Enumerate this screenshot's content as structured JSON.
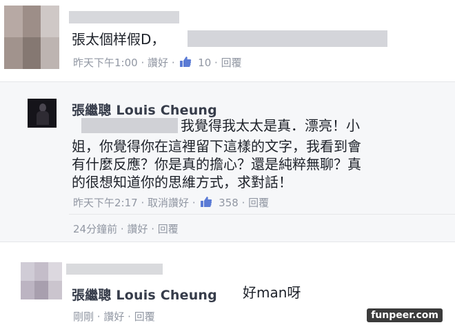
{
  "comments": [
    {
      "text": "張太個样假D，",
      "meta": {
        "time": "昨天下午1:00",
        "action": "讚好",
        "likes": "10",
        "reply": "回覆"
      }
    }
  ],
  "reply": {
    "author": "張繼聰 Louis Cheung",
    "lines": [
      "我覺得我太太是真．漂亮！小",
      "姐，你覺得你在這裡留下這樣的文字，我看到會",
      "有什麼反應？你是真的擔心？還是純粹無聊？真",
      "的很想知道你的思維方式，求對話！"
    ],
    "meta": {
      "time": "昨天下午2:17",
      "action": "取消讚好",
      "likes": "358",
      "reply": "回覆"
    }
  },
  "sub_meta": {
    "time": "24分鐘前",
    "action": "讚好",
    "reply": "回覆"
  },
  "last": {
    "author": "張繼聰 Louis Cheung",
    "text": "好man呀",
    "meta": {
      "time": "剛剛",
      "action": "讚好",
      "reply": "回覆"
    }
  },
  "watermark": "funpeer.com",
  "colors": {
    "like_blue": "#5b7bd5",
    "meta_gray": "#9197a3",
    "name_gray": "#363c4a"
  }
}
